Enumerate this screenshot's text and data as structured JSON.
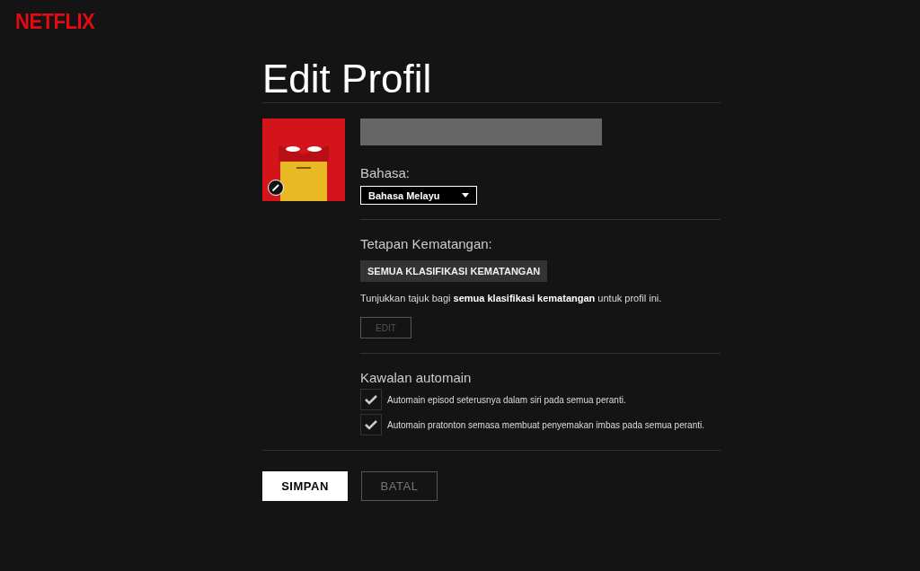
{
  "logo": "NETFLIX",
  "title": "Edit Profil",
  "language": {
    "label": "Bahasa:",
    "value": "Bahasa Melayu"
  },
  "maturity": {
    "label": "Tetapan Kematangan:",
    "badge": "SEMUA KLASIFIKASI KEMATANGAN",
    "description": "Tunjukkan tajuk bagi **semua klasifikasi kematangan** untuk profil ini.",
    "edit_button": "EDIT"
  },
  "autoplay": {
    "label": "Kawalan automain",
    "options": [
      {
        "label": "Automain episod seterusnya dalam siri pada semua peranti.",
        "checked": true
      },
      {
        "label": "Automain pratonton semasa membuat penyemakan imbas pada semua peranti.",
        "checked": true
      }
    ]
  },
  "buttons": [
    {
      "label": "SIMPAN",
      "kind": "primary"
    },
    {
      "label": "BATAL",
      "kind": "secondary"
    }
  ]
}
